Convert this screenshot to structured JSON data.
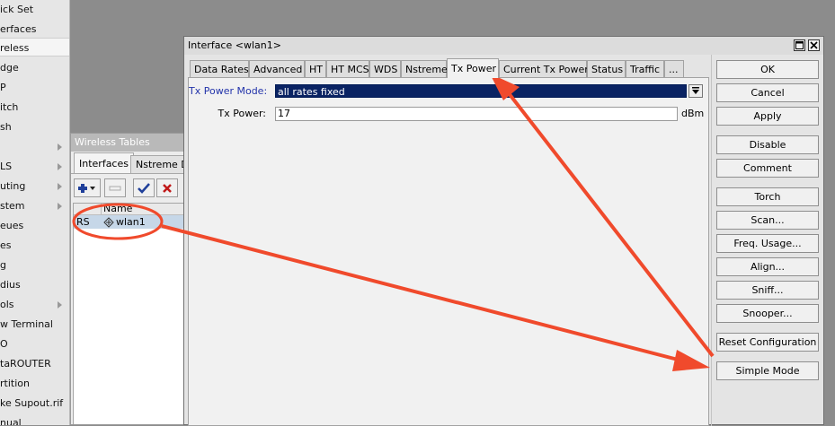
{
  "left_menu": {
    "items": [
      {
        "label": "ick Set",
        "has_submenu": false,
        "selected": false
      },
      {
        "label": "erfaces",
        "has_submenu": false,
        "selected": false
      },
      {
        "label": "reless",
        "has_submenu": false,
        "selected": true
      },
      {
        "label": "dge",
        "has_submenu": false,
        "selected": false
      },
      {
        "label": "P",
        "has_submenu": false,
        "selected": false
      },
      {
        "label": "itch",
        "has_submenu": false,
        "selected": false
      },
      {
        "label": "sh",
        "has_submenu": false,
        "selected": false
      },
      {
        "label": "",
        "has_submenu": true,
        "selected": false
      },
      {
        "label": "LS",
        "has_submenu": true,
        "selected": false
      },
      {
        "label": "uting",
        "has_submenu": true,
        "selected": false
      },
      {
        "label": "stem",
        "has_submenu": true,
        "selected": false
      },
      {
        "label": "eues",
        "has_submenu": false,
        "selected": false
      },
      {
        "label": "es",
        "has_submenu": false,
        "selected": false
      },
      {
        "label": "g",
        "has_submenu": false,
        "selected": false
      },
      {
        "label": "dius",
        "has_submenu": false,
        "selected": false
      },
      {
        "label": "ols",
        "has_submenu": true,
        "selected": false
      },
      {
        "label": "w Terminal",
        "has_submenu": false,
        "selected": false
      },
      {
        "label": "O",
        "has_submenu": false,
        "selected": false
      },
      {
        "label": "taROUTER",
        "has_submenu": false,
        "selected": false
      },
      {
        "label": "rtition",
        "has_submenu": false,
        "selected": false
      },
      {
        "label": "ke Supout.rif",
        "has_submenu": false,
        "selected": false
      },
      {
        "label": "nual",
        "has_submenu": false,
        "selected": false
      }
    ]
  },
  "wireless_tables": {
    "title": "Wireless Tables",
    "tabs": [
      {
        "label": "Interfaces",
        "active": true
      },
      {
        "label": "Nstreme Du",
        "active": false
      }
    ],
    "columns": {
      "name": "Name"
    },
    "rows": [
      {
        "flags": "RS",
        "name": "wlan1"
      }
    ]
  },
  "dialog": {
    "title": "Interface <wlan1>",
    "tabs": [
      {
        "label": "Data Rates",
        "active": false
      },
      {
        "label": "Advanced",
        "active": false
      },
      {
        "label": "HT",
        "active": false
      },
      {
        "label": "HT MCS",
        "active": false
      },
      {
        "label": "WDS",
        "active": false
      },
      {
        "label": "Nstreme",
        "active": false
      },
      {
        "label": "Tx Power",
        "active": true
      },
      {
        "label": "Current Tx Power",
        "active": false
      },
      {
        "label": "Status",
        "active": false
      },
      {
        "label": "Traffic",
        "active": false
      },
      {
        "label": "...",
        "active": false
      }
    ],
    "fields": {
      "tx_power_mode_label": "Tx Power Mode:",
      "tx_power_mode_value": "all rates fixed",
      "tx_power_label": "Tx Power:",
      "tx_power_value": "17",
      "tx_power_unit": "dBm"
    },
    "buttons": [
      "OK",
      "Cancel",
      "Apply",
      "Disable",
      "Comment",
      "Torch",
      "Scan...",
      "Freq. Usage...",
      "Align...",
      "Sniff...",
      "Snooper...",
      "Reset Configuration",
      "Simple Mode"
    ]
  },
  "colors": {
    "annotation": "#f04a2c",
    "selection": "#0a2363",
    "label_blue": "#2233aa"
  }
}
